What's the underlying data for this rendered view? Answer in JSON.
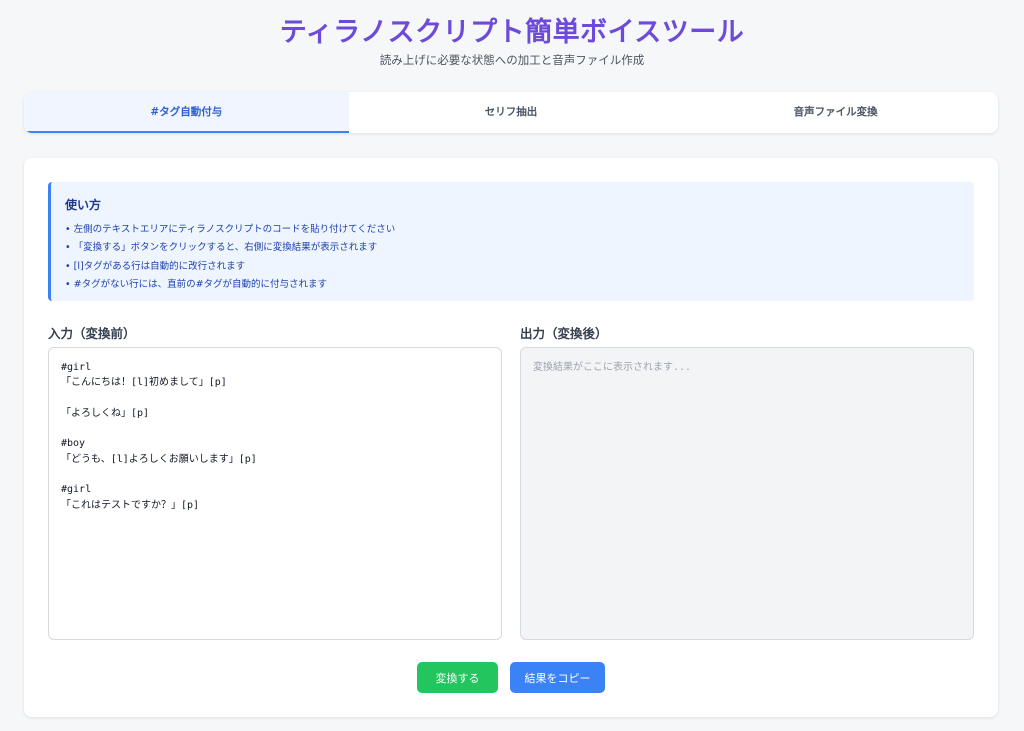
{
  "header": {
    "title": "ティラノスクリプト簡単ボイスツール",
    "subtitle": "読み上げに必要な状態への加工と音声ファイル作成"
  },
  "tabs": [
    {
      "label": "#タグ自動付与",
      "active": true
    },
    {
      "label": "セリフ抽出",
      "active": false
    },
    {
      "label": "音声ファイル変換",
      "active": false
    }
  ],
  "howto": {
    "title": "使い方",
    "items": [
      "• 左側のテキストエリアにティラノスクリプトのコードを貼り付けてください",
      "• 「変換する」ボタンをクリックすると、右側に変換結果が表示されます",
      "• [l]タグがある行は自動的に改行されます",
      "• #タグがない行には、直前の#タグが自動的に付与されます"
    ]
  },
  "input": {
    "label": "入力（変換前）",
    "value": "#girl\n「こんにちは！[l]初めまして」[p]\n\n「よろしくね」[p]\n\n#boy\n「どうも、[l]よろしくお願いします」[p]\n\n#girl\n「これはテストですか？」[p]"
  },
  "output": {
    "label": "出力（変換後）",
    "placeholder": "変換結果がここに表示されます...",
    "value": ""
  },
  "buttons": {
    "convert": "変換する",
    "copy": "結果をコピー"
  },
  "colors": {
    "title": "#6d4ad8",
    "accent": "#3b82f6",
    "convert": "#22c55e"
  }
}
